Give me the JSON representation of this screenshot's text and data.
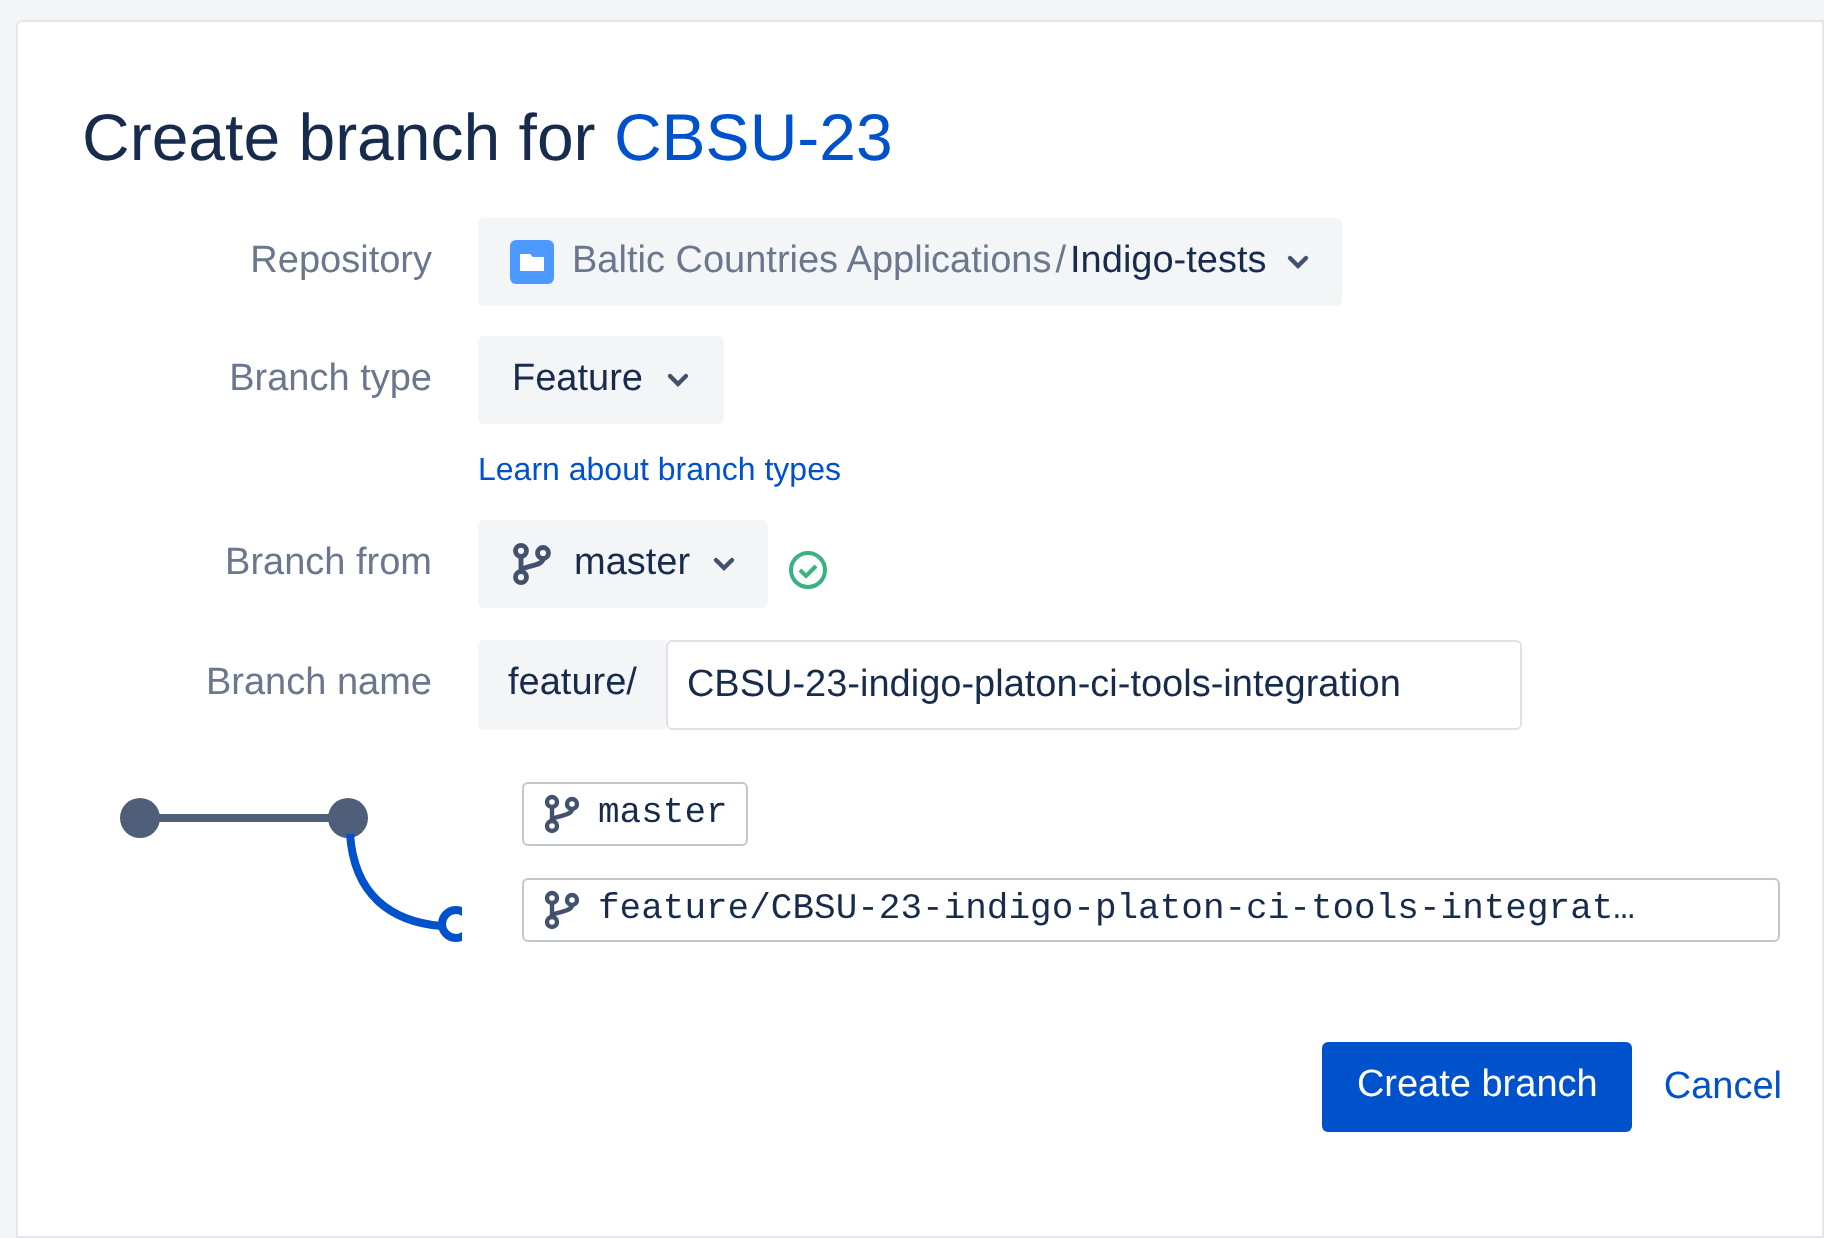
{
  "title": {
    "text": "Create branch for",
    "issue_key": "CBSU-23"
  },
  "fields": [
    {
      "kind": "repository",
      "label": "Repository",
      "project": "Baltic Countries Applications",
      "separator": "/",
      "repo": "Indigo-tests"
    },
    {
      "kind": "select",
      "label": "Branch type",
      "value": "Feature",
      "link": "Learn about branch types"
    },
    {
      "kind": "branch",
      "label": "Branch from",
      "value": "master",
      "valid": true
    },
    {
      "kind": "name",
      "label": "Branch name",
      "prefix": "feature/",
      "value": "CBSU-23-indigo-platon-ci-tools-integration"
    }
  ],
  "preview": {
    "source": "master",
    "target": "feature/CBSU-23-indigo-platon-ci-tools-integrat…"
  },
  "buttons": [
    {
      "label": "Create branch",
      "kind": "primary"
    },
    {
      "label": "Cancel",
      "kind": "link"
    }
  ]
}
